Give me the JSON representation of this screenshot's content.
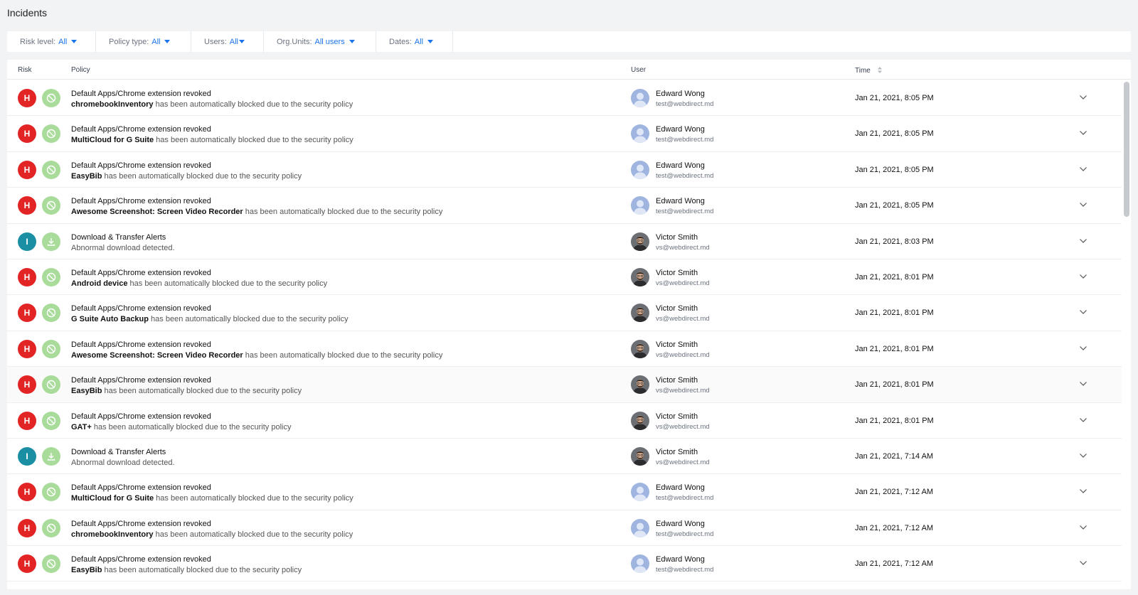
{
  "page": {
    "title": "Incidents"
  },
  "filters": [
    {
      "label": "Risk level:",
      "value": "All"
    },
    {
      "label": "Policy type:",
      "value": "All"
    },
    {
      "label": "Users:",
      "value": "All"
    },
    {
      "label": "Org.Units:",
      "value": "All users"
    },
    {
      "label": "Dates:",
      "value": "All"
    }
  ],
  "table": {
    "columns": {
      "risk": "Risk",
      "policy": "Policy",
      "user": "User",
      "time": "Time"
    },
    "rows": [
      {
        "risk": "H",
        "action": "blocked",
        "title": "Default Apps/Chrome extension revoked",
        "subject": "chromebookInventory",
        "desc": " has been automatically blocked due to the security policy",
        "user_name": "Edward Wong",
        "user_email": "test@webdirect.md",
        "avatar": "edward",
        "time": "Jan 21, 2021, 8:05 PM"
      },
      {
        "risk": "H",
        "action": "blocked",
        "title": "Default Apps/Chrome extension revoked",
        "subject": "MultiCloud for G Suite",
        "desc": " has been automatically blocked due to the security policy",
        "user_name": "Edward Wong",
        "user_email": "test@webdirect.md",
        "avatar": "edward",
        "time": "Jan 21, 2021, 8:05 PM"
      },
      {
        "risk": "H",
        "action": "blocked",
        "title": "Default Apps/Chrome extension revoked",
        "subject": "EasyBib",
        "desc": " has been automatically blocked due to the security policy",
        "user_name": "Edward Wong",
        "user_email": "test@webdirect.md",
        "avatar": "edward",
        "time": "Jan 21, 2021, 8:05 PM"
      },
      {
        "risk": "H",
        "action": "blocked",
        "title": "Default Apps/Chrome extension revoked",
        "subject": "Awesome Screenshot: Screen Video Recorder",
        "desc": " has been automatically blocked due to the security policy",
        "user_name": "Edward Wong",
        "user_email": "test@webdirect.md",
        "avatar": "edward",
        "time": "Jan 21, 2021, 8:05 PM"
      },
      {
        "risk": "I",
        "action": "download",
        "title": "Download & Transfer Alerts",
        "subject": "",
        "desc": "Abnormal download detected.",
        "user_name": "Victor Smith",
        "user_email": "vs@webdirect.md",
        "avatar": "victor",
        "time": "Jan 21, 2021, 8:03 PM"
      },
      {
        "risk": "H",
        "action": "blocked",
        "title": "Default Apps/Chrome extension revoked",
        "subject": "Android device",
        "desc": " has been automatically blocked due to the security policy",
        "user_name": "Victor Smith",
        "user_email": "vs@webdirect.md",
        "avatar": "victor",
        "time": "Jan 21, 2021, 8:01 PM"
      },
      {
        "risk": "H",
        "action": "blocked",
        "title": "Default Apps/Chrome extension revoked",
        "subject": "G Suite Auto Backup",
        "desc": " has been automatically blocked due to the security policy",
        "user_name": "Victor Smith",
        "user_email": "vs@webdirect.md",
        "avatar": "victor",
        "time": "Jan 21, 2021, 8:01 PM"
      },
      {
        "risk": "H",
        "action": "blocked",
        "title": "Default Apps/Chrome extension revoked",
        "subject": "Awesome Screenshot: Screen Video Recorder",
        "desc": " has been automatically blocked due to the security policy",
        "user_name": "Victor Smith",
        "user_email": "vs@webdirect.md",
        "avatar": "victor",
        "time": "Jan 21, 2021, 8:01 PM"
      },
      {
        "risk": "H",
        "action": "blocked",
        "title": "Default Apps/Chrome extension revoked",
        "subject": "EasyBib",
        "desc": " has been automatically blocked due to the security policy",
        "user_name": "Victor Smith",
        "user_email": "vs@webdirect.md",
        "avatar": "victor",
        "time": "Jan 21, 2021, 8:01 PM"
      },
      {
        "risk": "H",
        "action": "blocked",
        "title": "Default Apps/Chrome extension revoked",
        "subject": "GAT+",
        "desc": " has been automatically blocked due to the security policy",
        "user_name": "Victor Smith",
        "user_email": "vs@webdirect.md",
        "avatar": "victor",
        "time": "Jan 21, 2021, 8:01 PM"
      },
      {
        "risk": "I",
        "action": "download",
        "title": "Download & Transfer Alerts",
        "subject": "",
        "desc": "Abnormal download detected.",
        "user_name": "Victor Smith",
        "user_email": "vs@webdirect.md",
        "avatar": "victor",
        "time": "Jan 21, 2021, 7:14 AM"
      },
      {
        "risk": "H",
        "action": "blocked",
        "title": "Default Apps/Chrome extension revoked",
        "subject": "MultiCloud for G Suite",
        "desc": " has been automatically blocked due to the security policy",
        "user_name": "Edward Wong",
        "user_email": "test@webdirect.md",
        "avatar": "edward",
        "time": "Jan 21, 2021, 7:12 AM"
      },
      {
        "risk": "H",
        "action": "blocked",
        "title": "Default Apps/Chrome extension revoked",
        "subject": "chromebookInventory",
        "desc": " has been automatically blocked due to the security policy",
        "user_name": "Edward Wong",
        "user_email": "test@webdirect.md",
        "avatar": "edward",
        "time": "Jan 21, 2021, 7:12 AM"
      },
      {
        "risk": "H",
        "action": "blocked",
        "title": "Default Apps/Chrome extension revoked",
        "subject": "EasyBib",
        "desc": " has been automatically blocked due to the security policy",
        "user_name": "Edward Wong",
        "user_email": "test@webdirect.md",
        "avatar": "edward",
        "time": "Jan 21, 2021, 7:12 AM"
      }
    ]
  },
  "icons": {
    "blocked": "block-icon",
    "download": "download-icon",
    "expand": "chevron-down-icon",
    "sort": "sort-icon"
  },
  "colors": {
    "accent": "#1a73e8",
    "risk_high": "#e22424",
    "risk_info": "#1a8fa3",
    "action_green": "#a9dc9b"
  }
}
